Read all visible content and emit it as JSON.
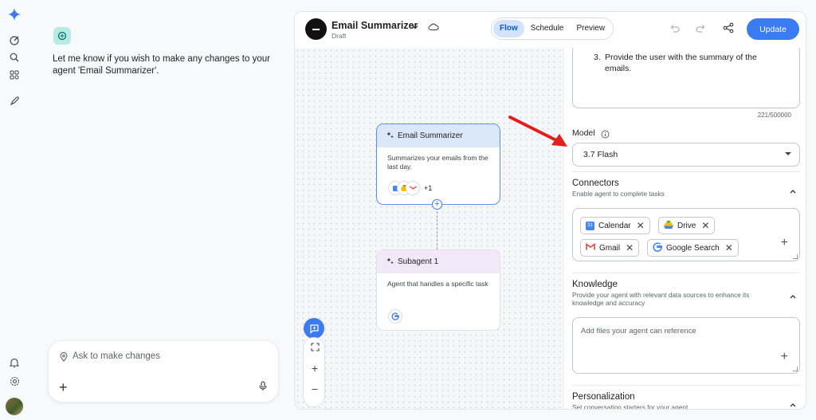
{
  "chat": {
    "message": "Let me know if you wish to make any changes to your agent 'Email Summarizer'.",
    "composer_placeholder": "Ask to make changes"
  },
  "agent": {
    "name": "Email Summarizer",
    "status": "Draft"
  },
  "view_tabs": [
    {
      "label": "Flow",
      "active": true
    },
    {
      "label": "Schedule",
      "active": false
    },
    {
      "label": "Preview",
      "active": false
    }
  ],
  "toolbar": {
    "update_label": "Update"
  },
  "canvas": {
    "main_node": {
      "title": "Email Summarizer",
      "description": "Summarizes your emails from the last day.",
      "extra_count": "+1"
    },
    "sub_node": {
      "title": "Subagent 1",
      "description": "Agent that handles a specific task"
    }
  },
  "panel": {
    "instructions_number": "3.",
    "instructions_text": "Provide the user with the summary of the emails.",
    "char_counter": "221/500000",
    "model_label": "Model",
    "model_value": "3.7 Flash",
    "connectors": {
      "title": "Connectors",
      "subtitle": "Enable agent to complete tasks",
      "chips": [
        "Calendar",
        "Drive",
        "Gmail",
        "Google Search"
      ]
    },
    "knowledge": {
      "title": "Knowledge",
      "subtitle": "Provide your agent with relevant data sources to enhance its knowledge and accuracy",
      "placeholder": "Add files your agent can reference"
    },
    "personalization": {
      "title": "Personalization",
      "subtitle": "Set conversation starters for your agent"
    }
  },
  "colors": {
    "accent": "#3b7bf2",
    "annotation_arrow": "#e21f1f"
  }
}
